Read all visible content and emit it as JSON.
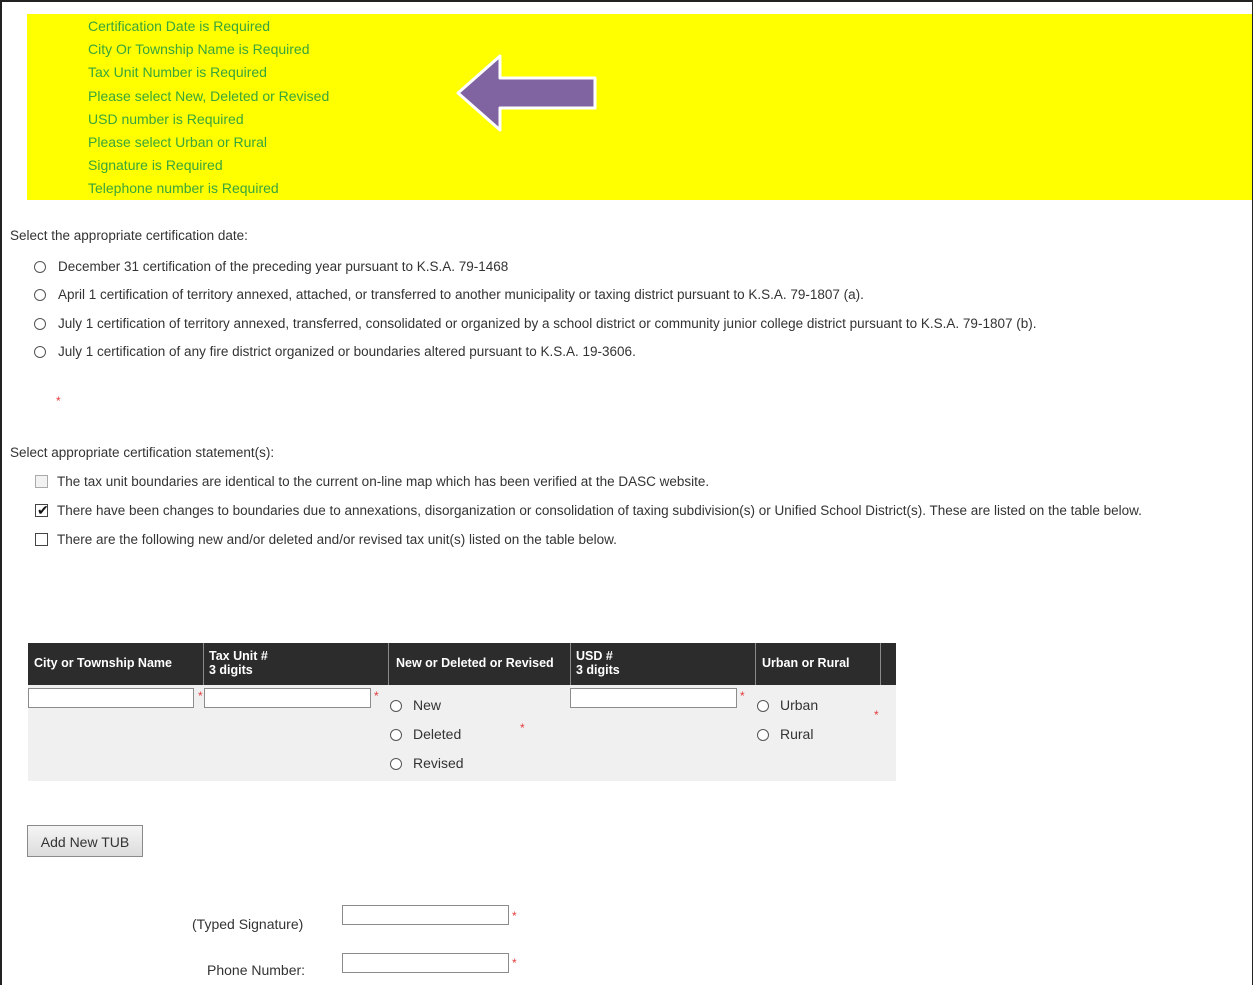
{
  "errors": [
    "Certification Date is Required",
    "City Or Township Name is Required",
    "Tax Unit Number is Required",
    "Please select New, Deleted or Revised",
    "USD number is Required",
    "Please select Urban or Rural",
    "Signature is Required",
    "Telephone number is Required"
  ],
  "arrow": {
    "icon": "left-arrow-icon",
    "color": "#8064a2"
  },
  "highlight_color": "#ffff00",
  "cert_date": {
    "prompt": "Select the appropriate certification date:",
    "options": [
      "December 31 certification of the preceding year pursuant to K.S.A. 79-1468",
      "April 1 certification of territory annexed, attached, or transferred to another municipality or taxing district pursuant to K.S.A. 79-1807 (a).",
      "July 1 certification of territory annexed, transferred, consolidated or organized by a school district or community junior college district pursuant to K.S.A. 79-1807 (b).",
      "July 1 certification of any fire district organized or boundaries altered pursuant to K.S.A. 19-3606."
    ]
  },
  "statements": {
    "prompt": "Select appropriate certification statement(s):",
    "options": [
      {
        "label": "The tax unit boundaries are identical to the current on-line map which has been verified at the DASC website.",
        "checked": false,
        "disabled": true
      },
      {
        "label": "There have been changes to boundaries due to annexations, disorganization or consolidation of taxing subdivision(s) or Unified School District(s). These are listed on the table below.",
        "checked": true,
        "disabled": false
      },
      {
        "label": "There are the following new and/or deleted and/or revised tax unit(s) listed on the table below.",
        "checked": false,
        "disabled": false
      }
    ]
  },
  "table": {
    "headers": {
      "city": "City or Township Name",
      "tax_unit": "Tax Unit #",
      "tax_unit_sub": "3 digits",
      "status": "New or Deleted or Revised",
      "usd": "USD #",
      "usd_sub": "3 digits",
      "urban_rural": "Urban or Rural"
    },
    "status_options": [
      "New",
      "Deleted",
      "Revised"
    ],
    "area_options": [
      "Urban",
      "Rural"
    ],
    "city_value": "",
    "tax_unit_value": "",
    "usd_value": ""
  },
  "add_button": "Add New TUB",
  "signature": {
    "label": "(Typed Signature)",
    "value": ""
  },
  "phone": {
    "label": "Phone Number:",
    "value": ""
  },
  "required_mark": "*"
}
